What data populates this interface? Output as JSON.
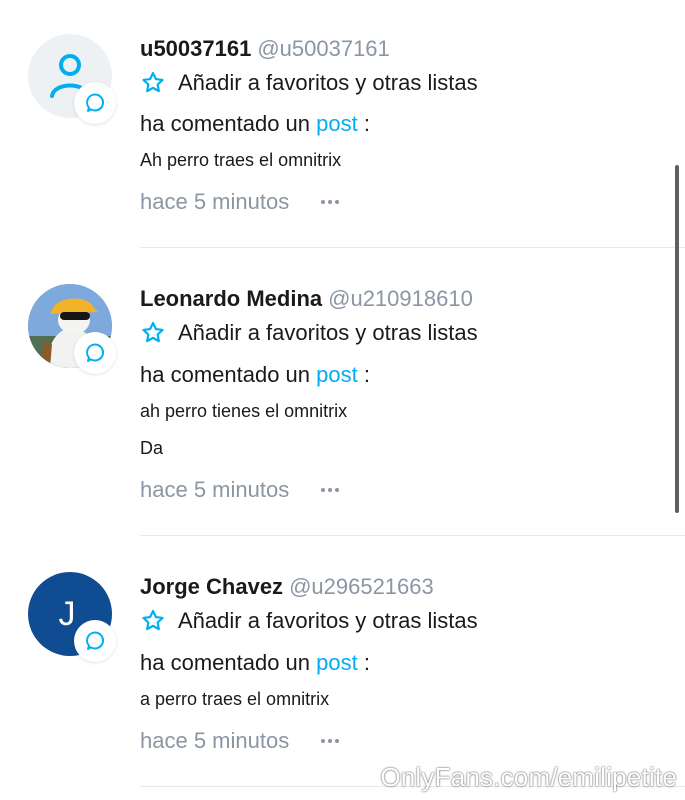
{
  "colors": {
    "accent": "#00aff0",
    "muted": "#8a96a3",
    "text": "#1a1a1a"
  },
  "icons": {
    "favorite": "star-outline-icon",
    "badge": "comment-bubble-icon",
    "more": "more-dots-icon"
  },
  "notifications": [
    {
      "name": "u50037161",
      "handle": "@u50037161",
      "fav_label": "Añadir a favoritos y otras listas",
      "action_prefix": "ha comentado un",
      "action_link": "post",
      "action_suffix": ":",
      "comment_lines": [
        "Ah perro traes el omnitrix"
      ],
      "time": "hace 5 minutos"
    },
    {
      "name": "Leonardo Medina",
      "handle": "@u210918610",
      "fav_label": "Añadir a favoritos y otras listas",
      "action_prefix": "ha comentado un",
      "action_link": "post",
      "action_suffix": ":",
      "comment_lines": [
        "ah perro tienes el omnitrix",
        "Da"
      ],
      "time": "hace 5 minutos"
    },
    {
      "name": "Jorge Chavez",
      "handle": "@u296521663",
      "fav_label": "Añadir a favoritos y otras listas",
      "action_prefix": "ha comentado un",
      "action_link": "post",
      "action_suffix": ":",
      "avatar_initial": "J",
      "comment_lines": [
        "a perro traes el omnitrix"
      ],
      "time": "hace 5 minutos"
    }
  ],
  "watermark": "OnlyFans.com/emilipetite"
}
